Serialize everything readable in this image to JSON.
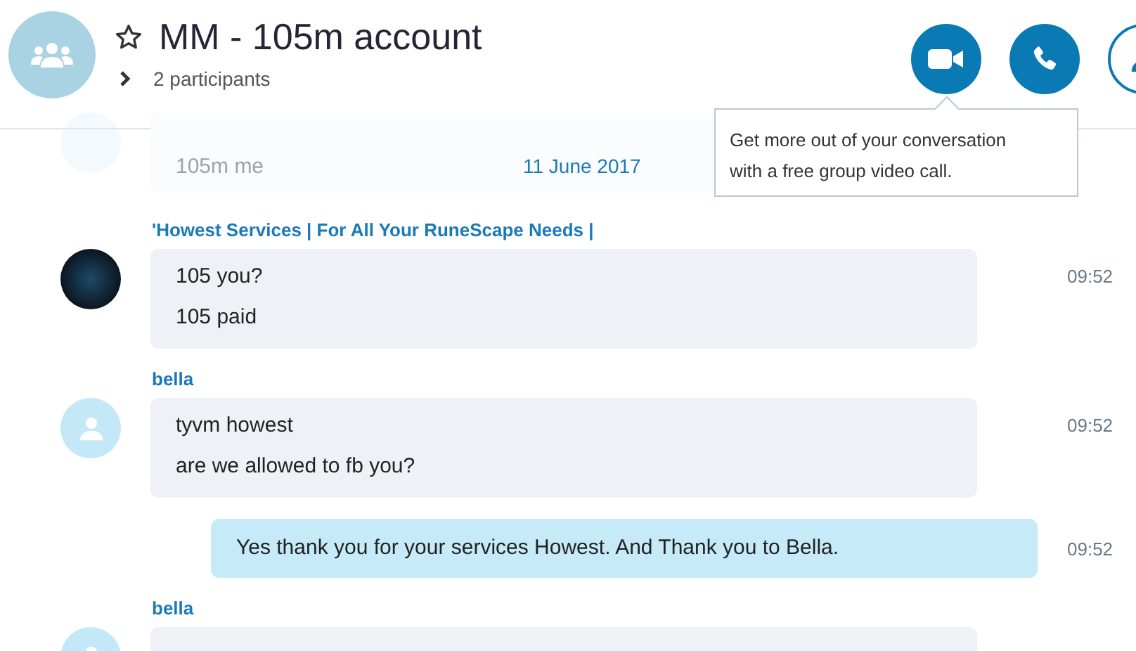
{
  "header": {
    "title": "MM - 105m account",
    "subtitle": "2 participants",
    "favorite": false,
    "tooltip": "Get more out of your conversation with a free group video call."
  },
  "messages": [
    {
      "kind": "faded",
      "lines": [
        "105m me"
      ],
      "date": "11 June 2017"
    },
    {
      "kind": "incoming",
      "avatar": {
        "kind": "photo"
      },
      "sender": "'Howest Services | For All Your RuneScape Needs |",
      "lines": [
        "105 you?",
        "105 paid"
      ],
      "time": "09:52"
    },
    {
      "kind": "incoming",
      "avatar": {
        "kind": "default"
      },
      "sender": "bella",
      "lines": [
        "tyvm howest",
        "are we allowed to fb you?"
      ],
      "time": "09:52"
    },
    {
      "kind": "outgoing",
      "lines": [
        "Yes thank you for your services Howest. And Thank you to Bella."
      ],
      "time": "09:52"
    },
    {
      "kind": "incoming",
      "avatar": {
        "kind": "default"
      },
      "sender": "bella"
    }
  ]
}
